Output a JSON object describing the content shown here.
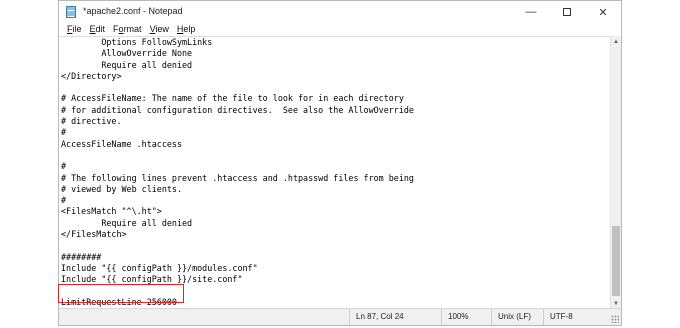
{
  "window": {
    "title": "*apache2.conf - Notepad",
    "minimize_glyph": "—",
    "close_glyph": "✕"
  },
  "menu": [
    {
      "mnemonic": "F",
      "rest": "ile"
    },
    {
      "mnemonic": "E",
      "rest": "dit"
    },
    {
      "lead": "F",
      "mnemonic": "o",
      "rest": "rmat"
    },
    {
      "mnemonic": "V",
      "rest": "iew"
    },
    {
      "mnemonic": "H",
      "rest": "elp"
    }
  ],
  "editor": {
    "lines": [
      "        Options FollowSymLinks",
      "        AllowOverride None",
      "        Require all denied",
      "</Directory>",
      "",
      "# AccessFileName: The name of the file to look for in each directory",
      "# for additional configuration directives.  See also the AllowOverride",
      "# directive.",
      "#",
      "AccessFileName .htaccess",
      "",
      "#",
      "# The following lines prevent .htaccess and .htpasswd files from being",
      "# viewed by Web clients.",
      "#",
      "<FilesMatch \"^\\.ht\">",
      "        Require all denied",
      "</FilesMatch>",
      "",
      "########",
      "Include \"{{ configPath }}/modules.conf\"",
      "Include \"{{ configPath }}/site.conf\"",
      "",
      "LimitRequestLine 256000"
    ]
  },
  "scrollbar": {
    "up_glyph": "▲",
    "down_glyph": "▼"
  },
  "status": {
    "position": "Ln 87, Col 24",
    "zoom": "100%",
    "line_endings": "Unix (LF)",
    "encoding": "UTF-8"
  },
  "colors": {
    "highlight": "#e02424"
  }
}
